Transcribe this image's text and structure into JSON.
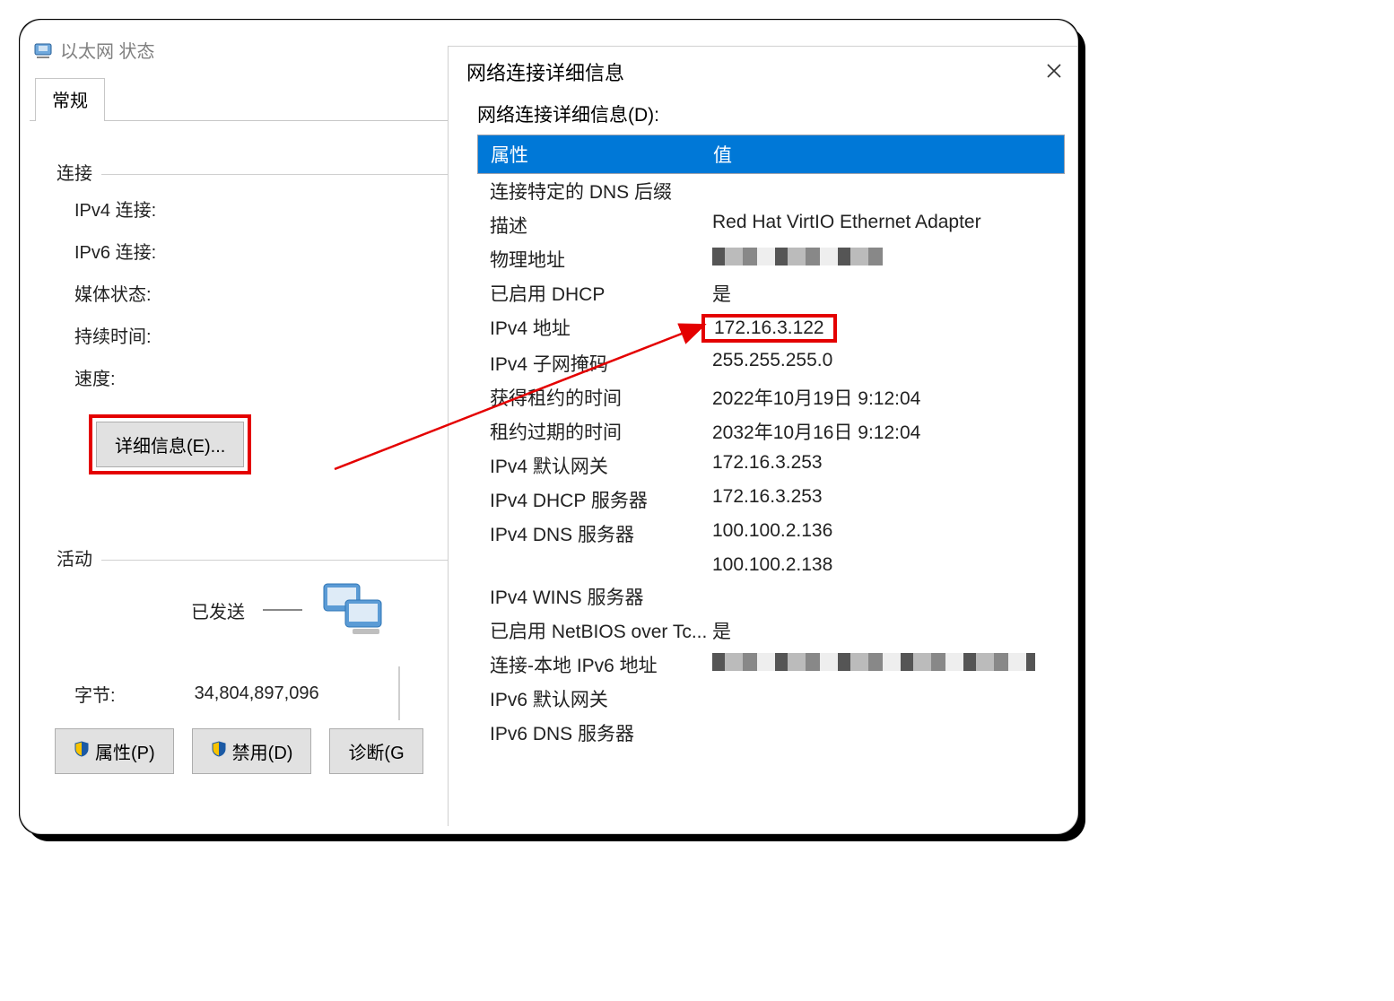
{
  "status_window": {
    "title": "以太网 状态",
    "tab_general": "常规",
    "group_connection": "连接",
    "labels": {
      "ipv4_conn": "IPv4 连接:",
      "ipv6_conn": "IPv6 连接:",
      "media_state": "媒体状态:",
      "duration": "持续时间:",
      "speed": "速度:"
    },
    "details_button": "详细信息(E)...",
    "group_activity": "活动",
    "sent_label": "已发送",
    "bytes_label": "字节:",
    "bytes_sent": "34,804,897,096",
    "buttons": {
      "properties": "属性(P)",
      "disable": "禁用(D)",
      "diagnose": "诊断(G"
    }
  },
  "details_dialog": {
    "title": "网络连接详细信息",
    "subtitle": "网络连接详细信息(D):",
    "col_property": "属性",
    "col_value": "值",
    "rows": [
      {
        "prop": "连接特定的 DNS 后缀",
        "val": ""
      },
      {
        "prop": "描述",
        "val": "Red Hat VirtIO Ethernet Adapter"
      },
      {
        "prop": "物理地址",
        "val": "",
        "censored": "w1"
      },
      {
        "prop": "已启用 DHCP",
        "val": "是"
      },
      {
        "prop": "IPv4 地址",
        "val": "172.16.3.122",
        "highlight": true
      },
      {
        "prop": "IPv4 子网掩码",
        "val": "255.255.255.0"
      },
      {
        "prop": "获得租约的时间",
        "val": "2022年10月19日 9:12:04"
      },
      {
        "prop": "租约过期的时间",
        "val": "2032年10月16日 9:12:04"
      },
      {
        "prop": "IPv4 默认网关",
        "val": "172.16.3.253"
      },
      {
        "prop": "IPv4 DHCP 服务器",
        "val": "172.16.3.253"
      },
      {
        "prop": "IPv4 DNS 服务器",
        "val": "100.100.2.136"
      },
      {
        "prop": "",
        "val": "100.100.2.138"
      },
      {
        "prop": "IPv4 WINS 服务器",
        "val": ""
      },
      {
        "prop": "已启用 NetBIOS over Tc...",
        "val": "是"
      },
      {
        "prop": "连接-本地 IPv6 地址",
        "val": "",
        "censored": "w2"
      },
      {
        "prop": "IPv6 默认网关",
        "val": ""
      },
      {
        "prop": "IPv6 DNS 服务器",
        "val": ""
      }
    ]
  }
}
